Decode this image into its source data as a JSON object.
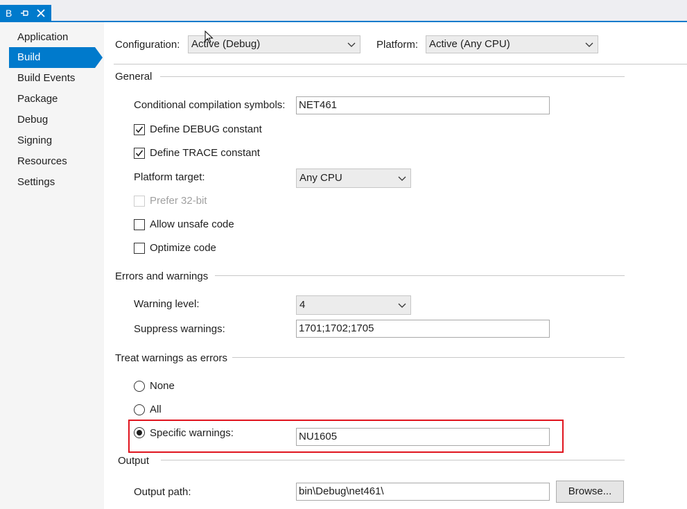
{
  "tab": {
    "title": "B"
  },
  "sidebar": {
    "items": [
      {
        "label": "Application"
      },
      {
        "label": "Build"
      },
      {
        "label": "Build Events"
      },
      {
        "label": "Package"
      },
      {
        "label": "Debug"
      },
      {
        "label": "Signing"
      },
      {
        "label": "Resources"
      },
      {
        "label": "Settings"
      }
    ],
    "selected": "Build"
  },
  "config": {
    "configuration_label": "Configuration:",
    "configuration_value": "Active (Debug)",
    "platform_label": "Platform:",
    "platform_value": "Active (Any CPU)"
  },
  "general": {
    "title": "General",
    "symbols_label": "Conditional compilation symbols:",
    "symbols_value": "NET461",
    "define_debug": {
      "label": "Define DEBUG constant",
      "checked": true
    },
    "define_trace": {
      "label": "Define TRACE constant",
      "checked": true
    },
    "platform_target_label": "Platform target:",
    "platform_target_value": "Any CPU",
    "prefer32": {
      "label": "Prefer 32-bit",
      "checked": false,
      "enabled": false
    },
    "unsafe": {
      "label": "Allow unsafe code",
      "checked": false
    },
    "optimize": {
      "label": "Optimize code",
      "checked": false
    }
  },
  "errors": {
    "title": "Errors and warnings",
    "warning_level_label": "Warning level:",
    "warning_level_value": "4",
    "suppress_label": "Suppress warnings:",
    "suppress_value": "1701;1702;1705"
  },
  "treat": {
    "title": "Treat warnings as errors",
    "none_label": "None",
    "all_label": "All",
    "specific_label": "Specific warnings:",
    "specific_value": "NU1605",
    "selected": "specific"
  },
  "output": {
    "title": "Output",
    "path_label": "Output path:",
    "path_value": "bin\\Debug\\net461\\",
    "browse_label": "Browse..."
  },
  "colors": {
    "accent": "#007acc",
    "highlight": "#e0141e",
    "sidebar_bg": "#f5f5f5"
  }
}
